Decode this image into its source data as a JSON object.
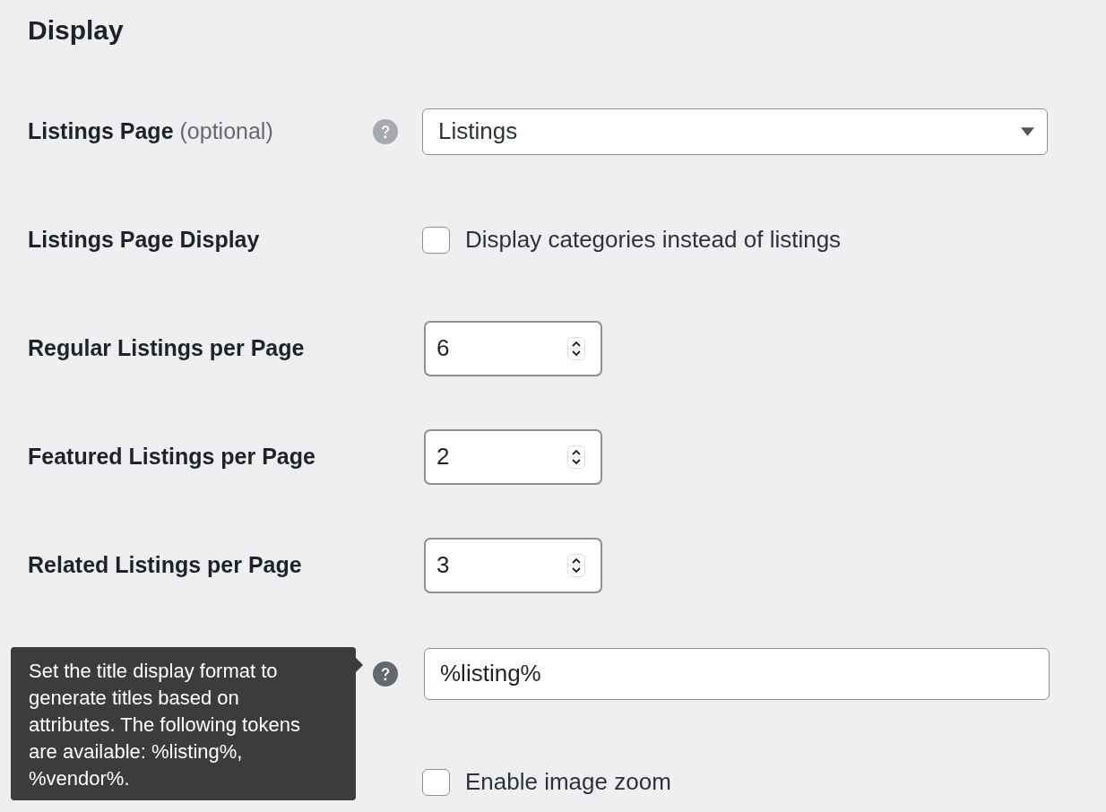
{
  "heading": "Display",
  "rows": [
    {
      "kind": "select",
      "label": "Listings Page",
      "label_note": "(optional)",
      "help": {
        "active": false
      },
      "value": "Listings"
    },
    {
      "kind": "checkbox",
      "label": "Listings Page Display",
      "checked": false,
      "text": "Display categories instead of listings"
    },
    {
      "kind": "number",
      "label": "Regular Listings per Page",
      "value": "6"
    },
    {
      "kind": "number",
      "label": "Featured Listings per Page",
      "value": "2"
    },
    {
      "kind": "number",
      "label": "Related Listings per Page",
      "value": "3"
    },
    {
      "kind": "text",
      "help": {
        "active": true,
        "tooltip": "Set the title display format to generate titles based on attributes. The following tokens are available: %listing%, %vendor%."
      },
      "value": "%listing%"
    },
    {
      "kind": "checkbox",
      "checked": false,
      "text": "Enable image zoom"
    }
  ]
}
